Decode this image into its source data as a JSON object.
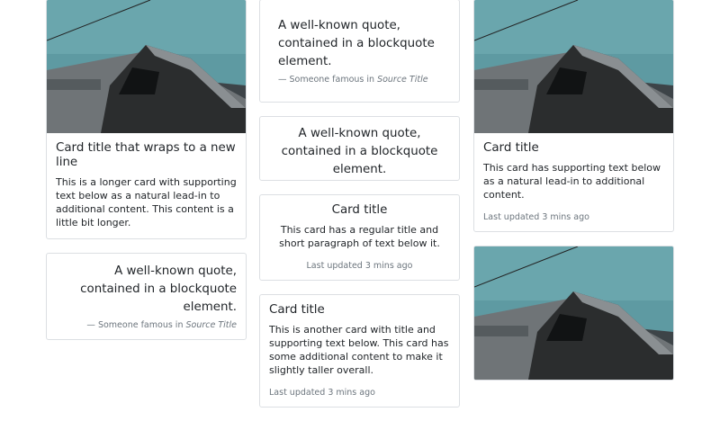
{
  "col1": {
    "card1": {
      "title": "Card title that wraps to a new line",
      "text": "This is a longer card with supporting text below as a natural lead-in to additional content. This content is a little bit longer."
    },
    "quote": {
      "text": "A well-known quote, contained in a blockquote element.",
      "footer_prefix": "— Someone famous in ",
      "source": "Source Title"
    }
  },
  "col2": {
    "quote1": {
      "text": "A well-known quote, contained in a blockquote element.",
      "footer_prefix": "— Someone famous in ",
      "source": "Source Title"
    },
    "quote2": {
      "text": "A well-known quote, contained in a blockquote element."
    },
    "card_center": {
      "title": "Card title",
      "text": "This card has a regular title and short paragraph of text below it.",
      "muted": "Last updated 3 mins ago"
    },
    "card_bottom": {
      "title": "Card title",
      "text": "This is another card with title and supporting text below. This card has some additional content to make it slightly taller overall.",
      "muted": "Last updated 3 mins ago"
    }
  },
  "col3": {
    "card1": {
      "title": "Card title",
      "text": "This card has supporting text below as a natural lead-in to additional content.",
      "muted": "Last updated 3 mins ago"
    }
  },
  "colors": {
    "sky": "#5e9aa2",
    "roof": "#6f7477",
    "wall": "#2b2d2e",
    "border": "#dcdfe3",
    "muted": "#6c757d"
  }
}
